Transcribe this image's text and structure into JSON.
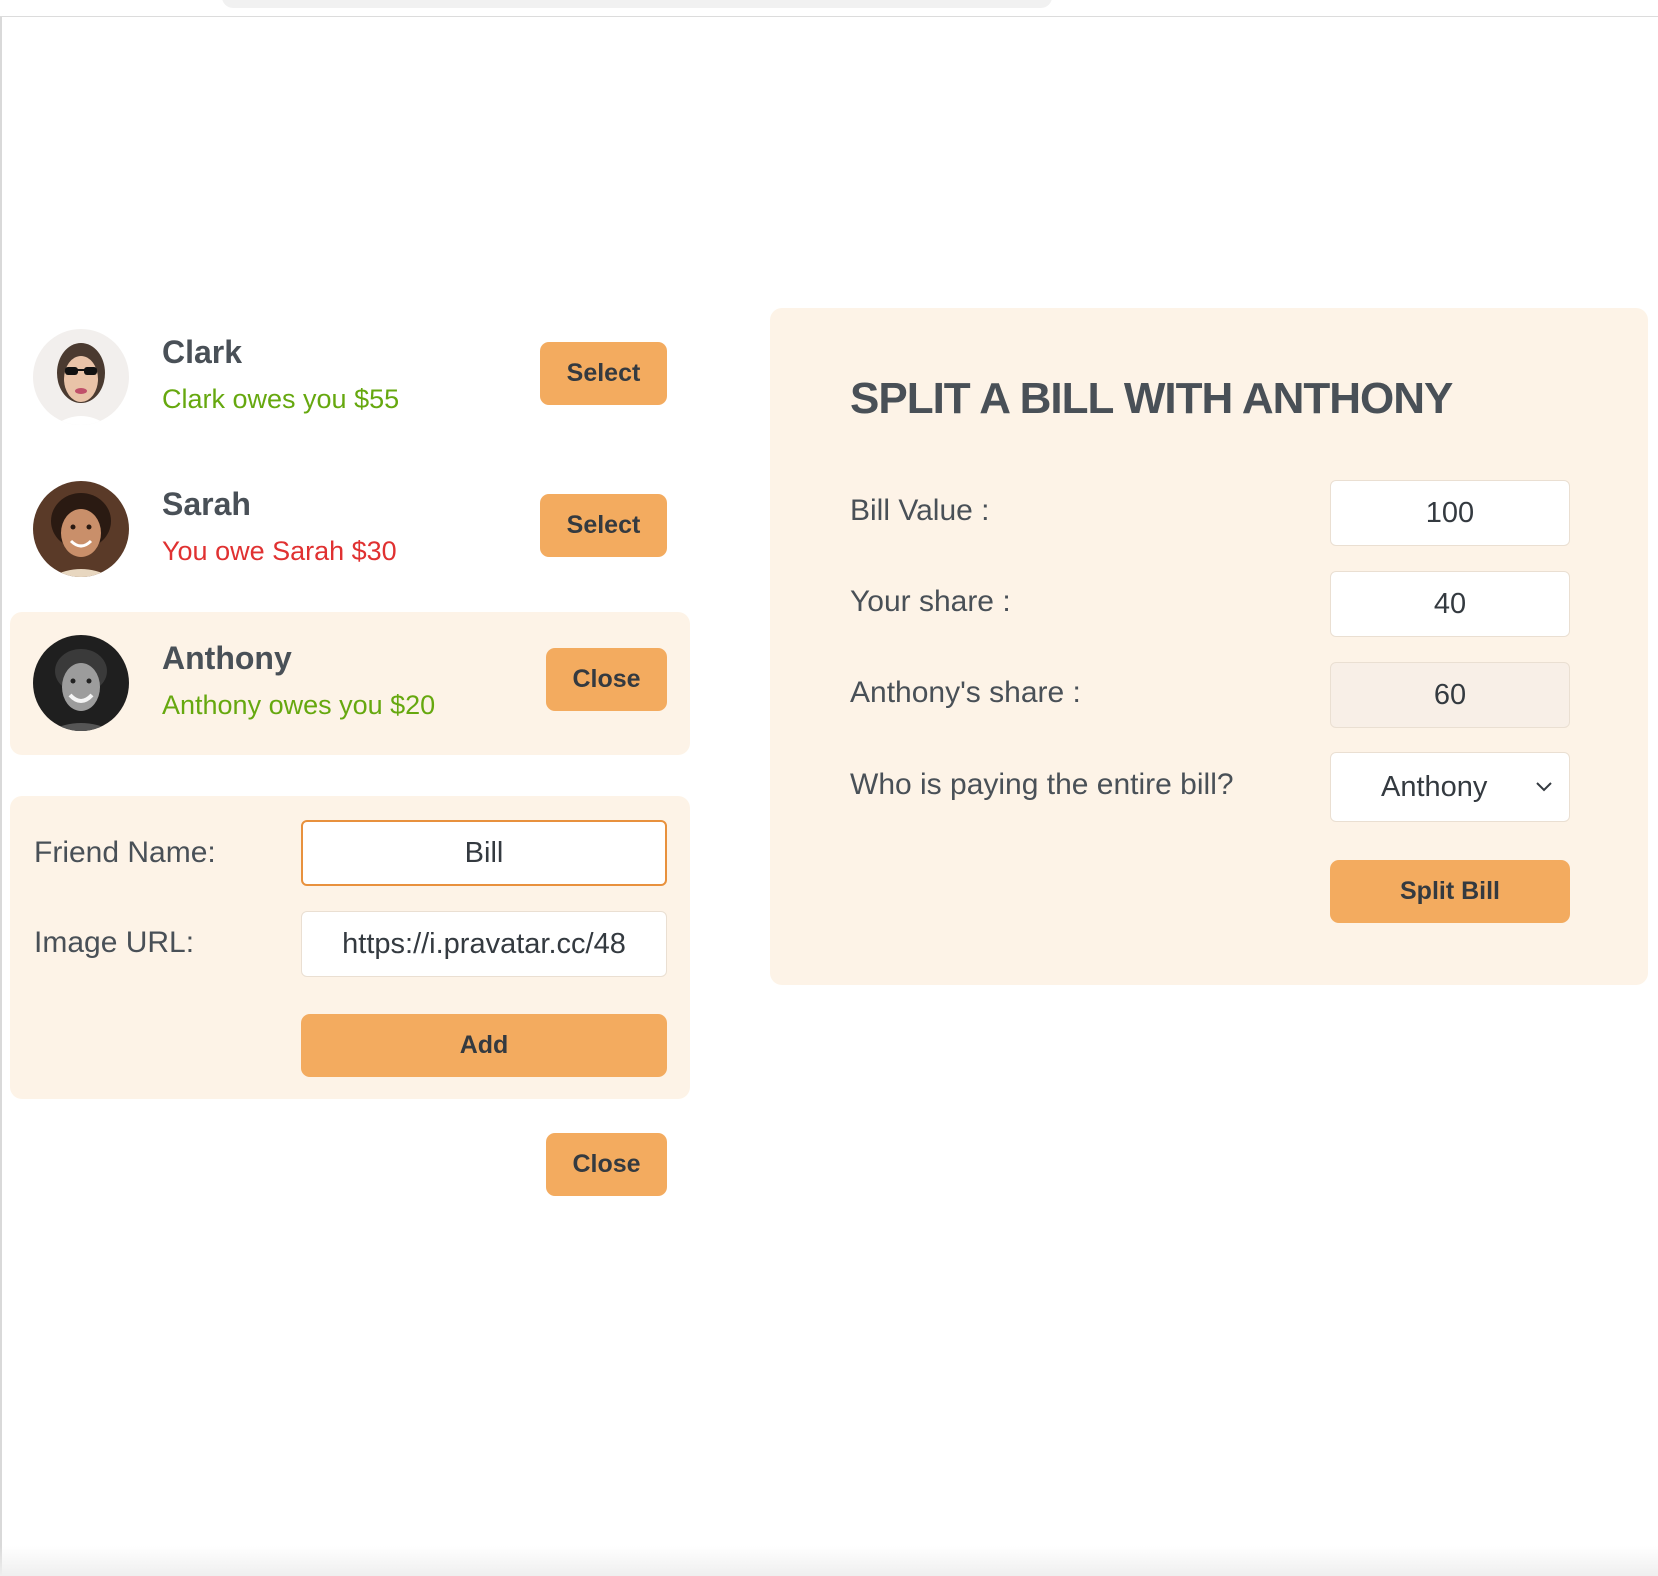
{
  "friends": [
    {
      "name": "Clark",
      "status": "Clark owes you $55",
      "status_type": "owes_you",
      "button_label": "Select",
      "selected": false
    },
    {
      "name": "Sarah",
      "status": "You owe Sarah $30",
      "status_type": "you_owe",
      "button_label": "Select",
      "selected": false
    },
    {
      "name": "Anthony",
      "status": "Anthony owes you $20",
      "status_type": "owes_you",
      "button_label": "Close",
      "selected": true
    }
  ],
  "add_friend_form": {
    "name_label": "Friend Name:",
    "name_value": "Bill",
    "image_label": "Image URL:",
    "image_value": "https://i.pravatar.cc/48",
    "submit_label": "Add"
  },
  "close_form_button_label": "Close",
  "split_bill": {
    "title": "Split a bill with Anthony",
    "bill_value_label": "Bill Value :",
    "bill_value": "100",
    "your_share_label": "Your share :",
    "your_share": "40",
    "friend_share_label": "Anthony's share :",
    "friend_share": "60",
    "payer_label": "Who is paying the entire bill?",
    "payer_selected": "Anthony",
    "submit_label": "Split Bill"
  },
  "colors": {
    "accent": "#f3ab5f",
    "panel_bg": "#fdf3e7",
    "green": "#66a80f",
    "red": "#e03131",
    "text": "#495057"
  }
}
